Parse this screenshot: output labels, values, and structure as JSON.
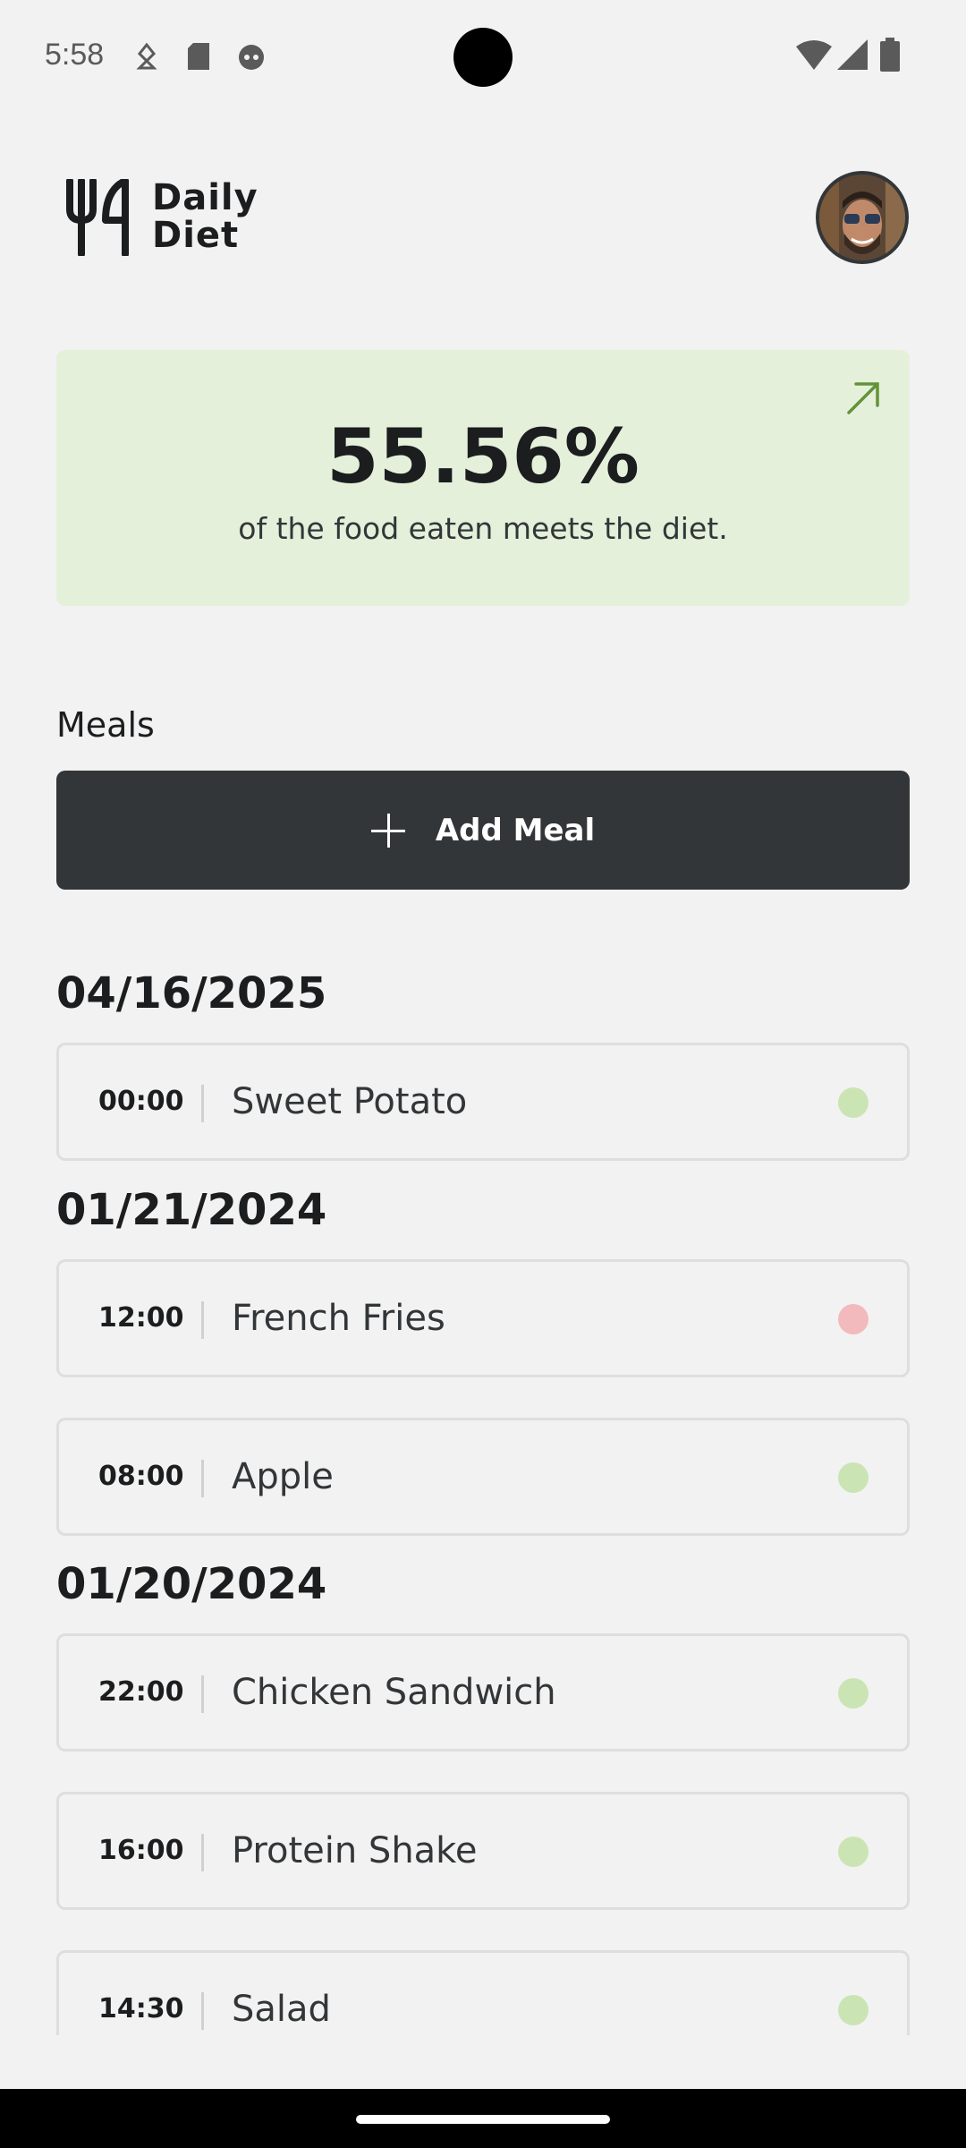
{
  "status_bar": {
    "time": "5:58"
  },
  "header": {
    "logo_line1": "Daily",
    "logo_line2": "Diet"
  },
  "stats": {
    "percent": "55.56%",
    "caption": "of the food eaten meets the diet."
  },
  "meals": {
    "title": "Meals",
    "add_label": "Add Meal",
    "groups": [
      {
        "date": "04/16/2025",
        "items": [
          {
            "time": "00:00",
            "name": "Sweet Potato",
            "on_diet": true
          }
        ]
      },
      {
        "date": "01/21/2024",
        "items": [
          {
            "time": "12:00",
            "name": "French Fries",
            "on_diet": false
          },
          {
            "time": "08:00",
            "name": "Apple",
            "on_diet": true
          }
        ]
      },
      {
        "date": "01/20/2024",
        "items": [
          {
            "time": "22:00",
            "name": "Chicken Sandwich",
            "on_diet": true
          },
          {
            "time": "16:00",
            "name": "Protein Shake",
            "on_diet": true
          },
          {
            "time": "14:30",
            "name": "Salad",
            "on_diet": true
          }
        ]
      }
    ]
  },
  "colors": {
    "on_diet": "#cbe4b4",
    "off_diet": "#f3bababd",
    "accent_green": "#639339",
    "card_green": "#e5f0db",
    "dark": "#333638"
  }
}
